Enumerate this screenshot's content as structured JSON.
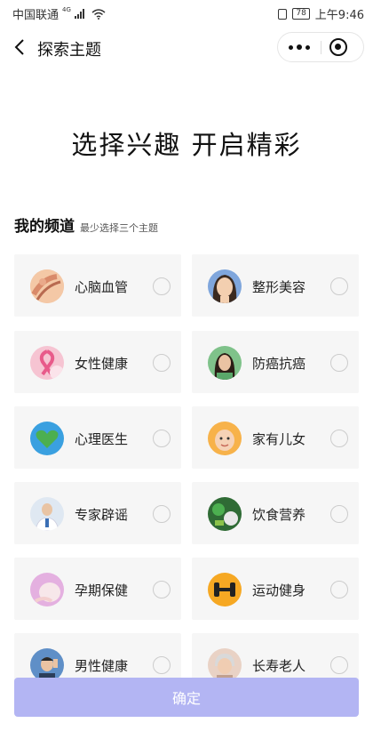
{
  "status_bar": {
    "carrier": "中国联通",
    "network": "4G",
    "battery": "78",
    "time": "上午9:46"
  },
  "nav": {
    "title": "探索主题"
  },
  "headline": "选择兴趣  开启精彩",
  "section": {
    "title": "我的频道",
    "subtitle": "最少选择三个主题"
  },
  "topics": [
    {
      "label": "心脑血管",
      "icon": "heart-anatomy-icon",
      "selected": false
    },
    {
      "label": "整形美容",
      "icon": "woman-face-icon",
      "selected": false
    },
    {
      "label": "女性健康",
      "icon": "pink-ribbon-icon",
      "selected": false
    },
    {
      "label": "防癌抗癌",
      "icon": "woman-portrait-icon",
      "selected": false
    },
    {
      "label": "心理医生",
      "icon": "green-heart-icon",
      "selected": false
    },
    {
      "label": "家有儿女",
      "icon": "baby-face-icon",
      "selected": false
    },
    {
      "label": "专家辟谣",
      "icon": "doctor-icon",
      "selected": false
    },
    {
      "label": "饮食营养",
      "icon": "vegetables-icon",
      "selected": false
    },
    {
      "label": "孕期保健",
      "icon": "pregnant-belly-icon",
      "selected": false
    },
    {
      "label": "运动健身",
      "icon": "dumbbell-icon",
      "selected": false
    },
    {
      "label": "男性健康",
      "icon": "man-headache-icon",
      "selected": false
    },
    {
      "label": "长寿老人",
      "icon": "elderly-woman-icon",
      "selected": false
    }
  ],
  "confirm_label": "确定",
  "colors": {
    "confirm_bg": "#b3b5f3",
    "card_bg": "#f6f6f6"
  }
}
